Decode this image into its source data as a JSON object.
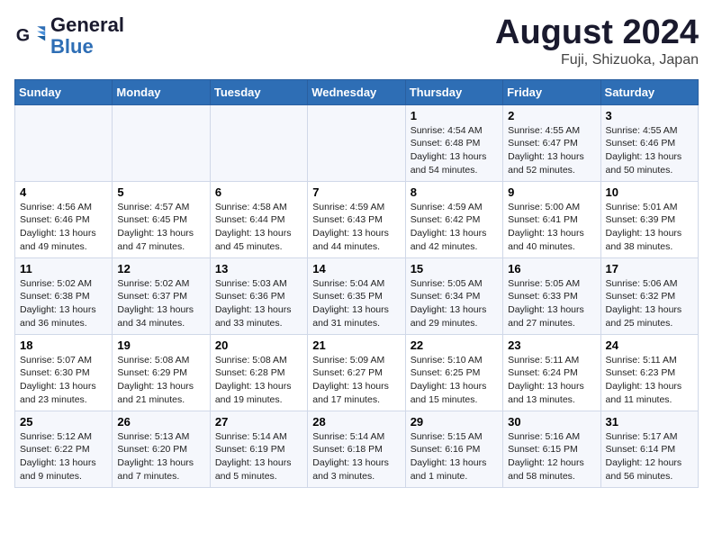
{
  "logo": {
    "line1": "General",
    "line2": "Blue"
  },
  "title": "August 2024",
  "subtitle": "Fuji, Shizuoka, Japan",
  "headers": [
    "Sunday",
    "Monday",
    "Tuesday",
    "Wednesday",
    "Thursday",
    "Friday",
    "Saturday"
  ],
  "weeks": [
    [
      {
        "day": "",
        "info": ""
      },
      {
        "day": "",
        "info": ""
      },
      {
        "day": "",
        "info": ""
      },
      {
        "day": "",
        "info": ""
      },
      {
        "day": "1",
        "info": "Sunrise: 4:54 AM\nSunset: 6:48 PM\nDaylight: 13 hours\nand 54 minutes."
      },
      {
        "day": "2",
        "info": "Sunrise: 4:55 AM\nSunset: 6:47 PM\nDaylight: 13 hours\nand 52 minutes."
      },
      {
        "day": "3",
        "info": "Sunrise: 4:55 AM\nSunset: 6:46 PM\nDaylight: 13 hours\nand 50 minutes."
      }
    ],
    [
      {
        "day": "4",
        "info": "Sunrise: 4:56 AM\nSunset: 6:46 PM\nDaylight: 13 hours\nand 49 minutes."
      },
      {
        "day": "5",
        "info": "Sunrise: 4:57 AM\nSunset: 6:45 PM\nDaylight: 13 hours\nand 47 minutes."
      },
      {
        "day": "6",
        "info": "Sunrise: 4:58 AM\nSunset: 6:44 PM\nDaylight: 13 hours\nand 45 minutes."
      },
      {
        "day": "7",
        "info": "Sunrise: 4:59 AM\nSunset: 6:43 PM\nDaylight: 13 hours\nand 44 minutes."
      },
      {
        "day": "8",
        "info": "Sunrise: 4:59 AM\nSunset: 6:42 PM\nDaylight: 13 hours\nand 42 minutes."
      },
      {
        "day": "9",
        "info": "Sunrise: 5:00 AM\nSunset: 6:41 PM\nDaylight: 13 hours\nand 40 minutes."
      },
      {
        "day": "10",
        "info": "Sunrise: 5:01 AM\nSunset: 6:39 PM\nDaylight: 13 hours\nand 38 minutes."
      }
    ],
    [
      {
        "day": "11",
        "info": "Sunrise: 5:02 AM\nSunset: 6:38 PM\nDaylight: 13 hours\nand 36 minutes."
      },
      {
        "day": "12",
        "info": "Sunrise: 5:02 AM\nSunset: 6:37 PM\nDaylight: 13 hours\nand 34 minutes."
      },
      {
        "day": "13",
        "info": "Sunrise: 5:03 AM\nSunset: 6:36 PM\nDaylight: 13 hours\nand 33 minutes."
      },
      {
        "day": "14",
        "info": "Sunrise: 5:04 AM\nSunset: 6:35 PM\nDaylight: 13 hours\nand 31 minutes."
      },
      {
        "day": "15",
        "info": "Sunrise: 5:05 AM\nSunset: 6:34 PM\nDaylight: 13 hours\nand 29 minutes."
      },
      {
        "day": "16",
        "info": "Sunrise: 5:05 AM\nSunset: 6:33 PM\nDaylight: 13 hours\nand 27 minutes."
      },
      {
        "day": "17",
        "info": "Sunrise: 5:06 AM\nSunset: 6:32 PM\nDaylight: 13 hours\nand 25 minutes."
      }
    ],
    [
      {
        "day": "18",
        "info": "Sunrise: 5:07 AM\nSunset: 6:30 PM\nDaylight: 13 hours\nand 23 minutes."
      },
      {
        "day": "19",
        "info": "Sunrise: 5:08 AM\nSunset: 6:29 PM\nDaylight: 13 hours\nand 21 minutes."
      },
      {
        "day": "20",
        "info": "Sunrise: 5:08 AM\nSunset: 6:28 PM\nDaylight: 13 hours\nand 19 minutes."
      },
      {
        "day": "21",
        "info": "Sunrise: 5:09 AM\nSunset: 6:27 PM\nDaylight: 13 hours\nand 17 minutes."
      },
      {
        "day": "22",
        "info": "Sunrise: 5:10 AM\nSunset: 6:25 PM\nDaylight: 13 hours\nand 15 minutes."
      },
      {
        "day": "23",
        "info": "Sunrise: 5:11 AM\nSunset: 6:24 PM\nDaylight: 13 hours\nand 13 minutes."
      },
      {
        "day": "24",
        "info": "Sunrise: 5:11 AM\nSunset: 6:23 PM\nDaylight: 13 hours\nand 11 minutes."
      }
    ],
    [
      {
        "day": "25",
        "info": "Sunrise: 5:12 AM\nSunset: 6:22 PM\nDaylight: 13 hours\nand 9 minutes."
      },
      {
        "day": "26",
        "info": "Sunrise: 5:13 AM\nSunset: 6:20 PM\nDaylight: 13 hours\nand 7 minutes."
      },
      {
        "day": "27",
        "info": "Sunrise: 5:14 AM\nSunset: 6:19 PM\nDaylight: 13 hours\nand 5 minutes."
      },
      {
        "day": "28",
        "info": "Sunrise: 5:14 AM\nSunset: 6:18 PM\nDaylight: 13 hours\nand 3 minutes."
      },
      {
        "day": "29",
        "info": "Sunrise: 5:15 AM\nSunset: 6:16 PM\nDaylight: 13 hours\nand 1 minute."
      },
      {
        "day": "30",
        "info": "Sunrise: 5:16 AM\nSunset: 6:15 PM\nDaylight: 12 hours\nand 58 minutes."
      },
      {
        "day": "31",
        "info": "Sunrise: 5:17 AM\nSunset: 6:14 PM\nDaylight: 12 hours\nand 56 minutes."
      }
    ]
  ]
}
